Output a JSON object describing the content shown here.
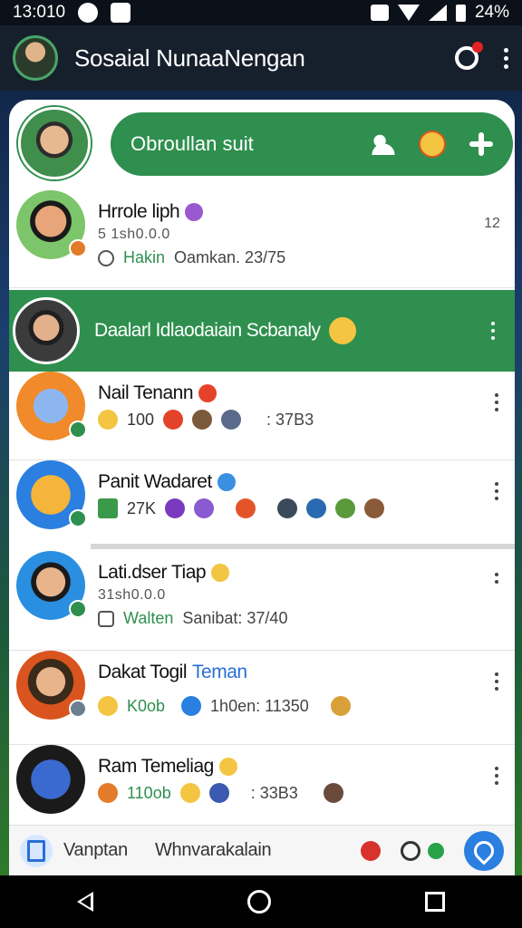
{
  "status_bar": {
    "time": "13:010",
    "battery": "24%"
  },
  "app_bar": {
    "title": "Sosaial NunaaNengan"
  },
  "compose": {
    "placeholder": "Obroullan suit"
  },
  "chats": [
    {
      "name": "Hrrole liph",
      "sub": "5 1sh0.0.0",
      "meta_accent": "Hakin",
      "meta_text": "Oamkan. 23/75",
      "side": "12"
    },
    {
      "name": "Nail Tenann",
      "count": "100",
      "meta_text": ": 37B3"
    },
    {
      "name": "Panit Wadaret",
      "count": "27K"
    },
    {
      "name": "Lati.dser Tiap",
      "sub": "31sh0.0.0",
      "meta_accent": "Walten",
      "meta_text": "Sanibat: 37/40"
    },
    {
      "name": "Dakat Togil",
      "name_accent": "Teman",
      "count": "K0ob",
      "meta_text": "1h0en: 11350"
    },
    {
      "name": "Ram Temeliag",
      "count": "110ob",
      "meta_text": ": 33B3"
    }
  ],
  "highlight": {
    "text": "Daalarl Idlaodaiain Scbanaly"
  },
  "bottom_bar": {
    "label_1": "Vanptan",
    "label_2": "Whnvarakalain"
  },
  "colors": {
    "primary_green": "#2f8f4e",
    "fab_blue": "#2a7fe0",
    "app_bar": "#16202c"
  }
}
